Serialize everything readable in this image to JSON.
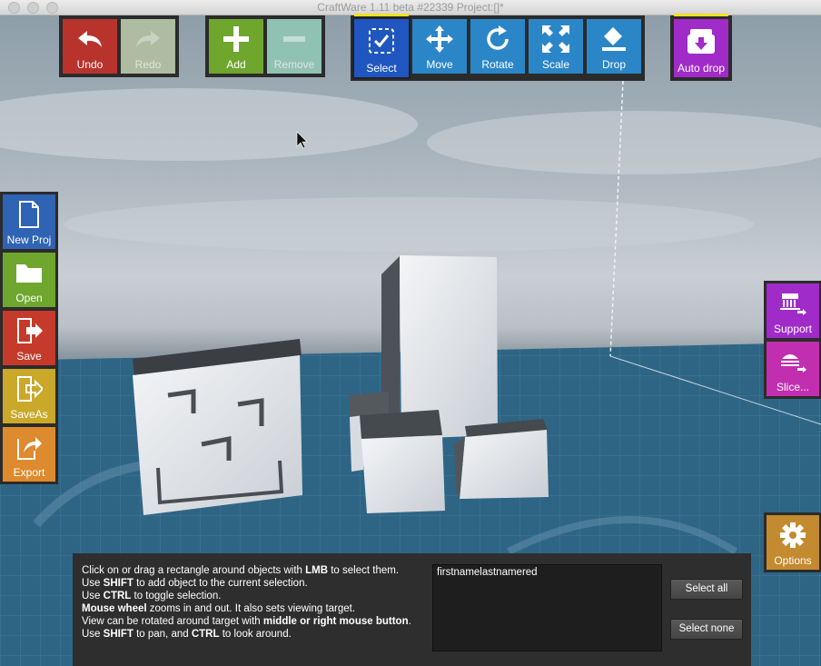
{
  "window": {
    "title": "CraftWare 1.11 beta #22339   Project:[]*"
  },
  "toolbar": {
    "undo": "Undo",
    "redo": "Redo",
    "add": "Add",
    "remove": "Remove",
    "select": "Select",
    "move": "Move",
    "rotate": "Rotate",
    "scale": "Scale",
    "drop": "Drop",
    "auto_drop": "Auto drop"
  },
  "sidebar_left": {
    "new_proj": "New Proj",
    "open": "Open",
    "save": "Save",
    "save_as": "SaveAs",
    "export": "Export"
  },
  "sidebar_right": {
    "support": "Support",
    "slice": "Slice..."
  },
  "options": "Options",
  "help": {
    "l1a": "Click on or drag a rectangle around objects with ",
    "l1b": "LMB",
    "l1c": " to select them.",
    "l2a": "Use ",
    "l2b": "SHIFT",
    "l2c": " to add object to the current selection.",
    "l3a": "Use ",
    "l3b": "CTRL",
    "l3c": " to toggle selection.",
    "l4a": "Mouse wheel",
    "l4b": " zooms in and out. It also sets viewing target.",
    "l5a": "View can be rotated around target with ",
    "l5b": "middle or right mouse button",
    "l5c": ".",
    "l6a": "Use ",
    "l6b": "SHIFT",
    "l6c": " to pan, and ",
    "l6d": "CTRL",
    "l6e": " to look around."
  },
  "objects_list": [
    "firstnamelastnamered"
  ],
  "actions": {
    "select_all": "Select all",
    "select_none": "Select none"
  },
  "colors": {
    "undo": "#b8332c",
    "green": "#6fa62e",
    "blue": "#2b86c8",
    "selected": "#1f56c0",
    "purple": "#a02bc8",
    "orange": "#de8a2e"
  }
}
